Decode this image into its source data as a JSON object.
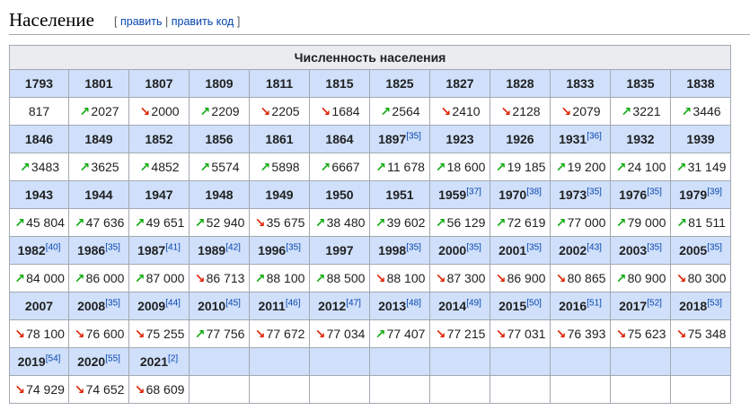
{
  "section": {
    "title": "Население",
    "bracket_open": "[",
    "bracket_close": "]",
    "edit": "править",
    "edit_sep": "|",
    "edit_code": "править код"
  },
  "table": {
    "caption": "Численность населения",
    "rows": [
      [
        {
          "year": "1793",
          "ref": "",
          "trend": "none",
          "value": "817"
        },
        {
          "year": "1801",
          "ref": "",
          "trend": "up",
          "value": "2027"
        },
        {
          "year": "1807",
          "ref": "",
          "trend": "down",
          "value": "2000"
        },
        {
          "year": "1809",
          "ref": "",
          "trend": "up",
          "value": "2209"
        },
        {
          "year": "1811",
          "ref": "",
          "trend": "down",
          "value": "2205"
        },
        {
          "year": "1815",
          "ref": "",
          "trend": "down",
          "value": "1684"
        },
        {
          "year": "1825",
          "ref": "",
          "trend": "up",
          "value": "2564"
        },
        {
          "year": "1827",
          "ref": "",
          "trend": "down",
          "value": "2410"
        },
        {
          "year": "1828",
          "ref": "",
          "trend": "down",
          "value": "2128"
        },
        {
          "year": "1833",
          "ref": "",
          "trend": "down",
          "value": "2079"
        },
        {
          "year": "1835",
          "ref": "",
          "trend": "up",
          "value": "3221"
        },
        {
          "year": "1838",
          "ref": "",
          "trend": "up",
          "value": "3446"
        }
      ],
      [
        {
          "year": "1846",
          "ref": "",
          "trend": "up",
          "value": "3483"
        },
        {
          "year": "1849",
          "ref": "",
          "trend": "up",
          "value": "3625"
        },
        {
          "year": "1852",
          "ref": "",
          "trend": "up",
          "value": "4852"
        },
        {
          "year": "1856",
          "ref": "",
          "trend": "up",
          "value": "5574"
        },
        {
          "year": "1861",
          "ref": "",
          "trend": "up",
          "value": "5898"
        },
        {
          "year": "1864",
          "ref": "",
          "trend": "up",
          "value": "6667"
        },
        {
          "year": "1897",
          "ref": "[35]",
          "trend": "up",
          "value": "11 678"
        },
        {
          "year": "1923",
          "ref": "",
          "trend": "up",
          "value": "18 600"
        },
        {
          "year": "1926",
          "ref": "",
          "trend": "up",
          "value": "19 185"
        },
        {
          "year": "1931",
          "ref": "[36]",
          "trend": "up",
          "value": "19 200"
        },
        {
          "year": "1932",
          "ref": "",
          "trend": "up",
          "value": "24 100"
        },
        {
          "year": "1939",
          "ref": "",
          "trend": "up",
          "value": "31 149"
        }
      ],
      [
        {
          "year": "1943",
          "ref": "",
          "trend": "up",
          "value": "45 804"
        },
        {
          "year": "1944",
          "ref": "",
          "trend": "up",
          "value": "47 636"
        },
        {
          "year": "1947",
          "ref": "",
          "trend": "up",
          "value": "49 651"
        },
        {
          "year": "1948",
          "ref": "",
          "trend": "up",
          "value": "52 940"
        },
        {
          "year": "1949",
          "ref": "",
          "trend": "down",
          "value": "35 675"
        },
        {
          "year": "1950",
          "ref": "",
          "trend": "up",
          "value": "38 480"
        },
        {
          "year": "1951",
          "ref": "",
          "trend": "up",
          "value": "39 602"
        },
        {
          "year": "1959",
          "ref": "[37]",
          "trend": "up",
          "value": "56 129"
        },
        {
          "year": "1970",
          "ref": "[38]",
          "trend": "up",
          "value": "72 619"
        },
        {
          "year": "1973",
          "ref": "[35]",
          "trend": "up",
          "value": "77 000"
        },
        {
          "year": "1976",
          "ref": "[35]",
          "trend": "up",
          "value": "79 000"
        },
        {
          "year": "1979",
          "ref": "[39]",
          "trend": "up",
          "value": "81 511"
        }
      ],
      [
        {
          "year": "1982",
          "ref": "[40]",
          "trend": "up",
          "value": "84 000"
        },
        {
          "year": "1986",
          "ref": "[35]",
          "trend": "up",
          "value": "86 000"
        },
        {
          "year": "1987",
          "ref": "[41]",
          "trend": "up",
          "value": "87 000"
        },
        {
          "year": "1989",
          "ref": "[42]",
          "trend": "down",
          "value": "86 713"
        },
        {
          "year": "1996",
          "ref": "[35]",
          "trend": "up",
          "value": "88 100"
        },
        {
          "year": "1997",
          "ref": "",
          "trend": "up",
          "value": "88 500"
        },
        {
          "year": "1998",
          "ref": "[35]",
          "trend": "down",
          "value": "88 100"
        },
        {
          "year": "2000",
          "ref": "[35]",
          "trend": "down",
          "value": "87 300"
        },
        {
          "year": "2001",
          "ref": "[35]",
          "trend": "down",
          "value": "86 900"
        },
        {
          "year": "2002",
          "ref": "[43]",
          "trend": "down",
          "value": "80 865"
        },
        {
          "year": "2003",
          "ref": "[35]",
          "trend": "up",
          "value": "80 900"
        },
        {
          "year": "2005",
          "ref": "[35]",
          "trend": "down",
          "value": "80 300"
        }
      ],
      [
        {
          "year": "2007",
          "ref": "",
          "trend": "down",
          "value": "78 100"
        },
        {
          "year": "2008",
          "ref": "[35]",
          "trend": "down",
          "value": "76 600"
        },
        {
          "year": "2009",
          "ref": "[44]",
          "trend": "down",
          "value": "75 255"
        },
        {
          "year": "2010",
          "ref": "[45]",
          "trend": "up",
          "value": "77 756"
        },
        {
          "year": "2011",
          "ref": "[46]",
          "trend": "down",
          "value": "77 672"
        },
        {
          "year": "2012",
          "ref": "[47]",
          "trend": "down",
          "value": "77 034"
        },
        {
          "year": "2013",
          "ref": "[48]",
          "trend": "up",
          "value": "77 407"
        },
        {
          "year": "2014",
          "ref": "[49]",
          "trend": "down",
          "value": "77 215"
        },
        {
          "year": "2015",
          "ref": "[50]",
          "trend": "down",
          "value": "77 031"
        },
        {
          "year": "2016",
          "ref": "[51]",
          "trend": "down",
          "value": "76 393"
        },
        {
          "year": "2017",
          "ref": "[52]",
          "trend": "down",
          "value": "75 623"
        },
        {
          "year": "2018",
          "ref": "[53]",
          "trend": "down",
          "value": "75 348"
        }
      ],
      [
        {
          "year": "2019",
          "ref": "[54]",
          "trend": "down",
          "value": "74 929"
        },
        {
          "year": "2020",
          "ref": "[55]",
          "trend": "down",
          "value": "74 652"
        },
        {
          "year": "2021",
          "ref": "[2]",
          "trend": "down",
          "value": "68 609"
        },
        null,
        null,
        null,
        null,
        null,
        null,
        null,
        null,
        null
      ]
    ]
  },
  "icons": {
    "up": "arrow-up-right-icon",
    "down": "arrow-down-right-icon",
    "up_color": "#11aa11",
    "down_color": "#dd2200",
    "header_bg": "#d0e0fb",
    "caption_bg": "#eaecf0",
    "link_color": "#0645ad"
  }
}
